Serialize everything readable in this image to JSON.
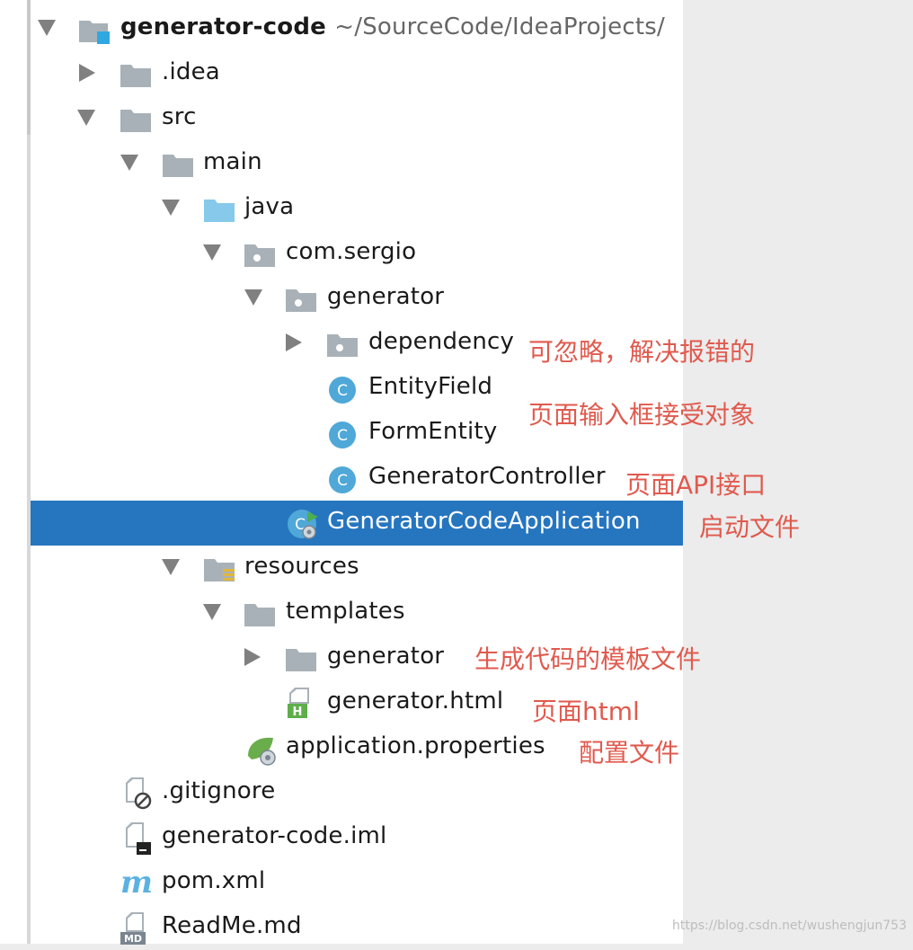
{
  "root": {
    "name": "generator-code",
    "path": "~/SourceCode/IdeaProjects/"
  },
  "tree": [
    {
      "label": "generator-code",
      "icon": "project-folder-icon"
    },
    {
      "label": ".idea",
      "icon": "folder-icon"
    },
    {
      "label": "src",
      "icon": "folder-icon"
    },
    {
      "label": "main",
      "icon": "folder-icon"
    },
    {
      "label": "java",
      "icon": "source-folder-icon"
    },
    {
      "label": "com.sergio",
      "icon": "package-icon"
    },
    {
      "label": "generator",
      "icon": "package-icon"
    },
    {
      "label": "dependency",
      "icon": "package-icon"
    },
    {
      "label": "EntityField",
      "icon": "class-icon"
    },
    {
      "label": "FormEntity",
      "icon": "class-icon"
    },
    {
      "label": "GeneratorController",
      "icon": "class-icon"
    },
    {
      "label": "GeneratorCodeApplication",
      "icon": "spring-boot-class-icon"
    },
    {
      "label": "resources",
      "icon": "resources-folder-icon"
    },
    {
      "label": "templates",
      "icon": "folder-icon"
    },
    {
      "label": "generator",
      "icon": "folder-icon"
    },
    {
      "label": "generator.html",
      "icon": "html-file-icon"
    },
    {
      "label": "application.properties",
      "icon": "spring-properties-icon"
    },
    {
      "label": ".gitignore",
      "icon": "gitignore-file-icon"
    },
    {
      "label": "generator-code.iml",
      "icon": "iml-file-icon"
    },
    {
      "label": "pom.xml",
      "icon": "maven-icon"
    },
    {
      "label": "ReadMe.md",
      "icon": "markdown-file-icon"
    }
  ],
  "annotations": {
    "dependency": "可忽略，解决报错的",
    "form_entity": "页面输入框接受对象",
    "controller": "页面API接口",
    "application": "启动文件",
    "templates_generator": "生成代码的模板文件",
    "html": "页面html",
    "properties": "配置文件"
  },
  "watermark": "https://blog.csdn.net/wushengjun753",
  "colors": {
    "selection": "#2675bf",
    "annotation": "#e05a4e",
    "folder": "#a9b1b8",
    "source_folder": "#86c9ea",
    "class": "#4fa8d8"
  }
}
